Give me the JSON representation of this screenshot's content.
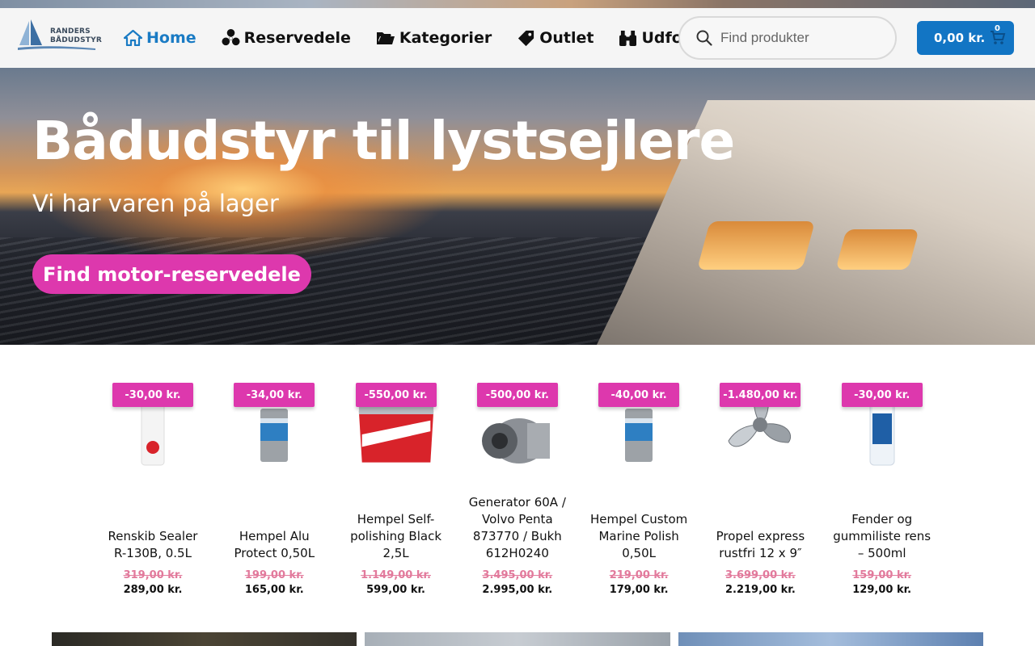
{
  "header": {
    "logo_line1": "RANDERS",
    "logo_line2": "BÅDUDSTYR",
    "nav": [
      {
        "label": "Home",
        "icon": "home-icon",
        "active": true
      },
      {
        "label": "Reservedele",
        "icon": "fan-icon"
      },
      {
        "label": "Kategorier",
        "icon": "folder-icon"
      },
      {
        "label": "Outlet",
        "icon": "tag-icon"
      },
      {
        "label": "Udforsk",
        "icon": "binoculars-icon"
      }
    ],
    "search_placeholder": "Find produkter",
    "cart_total": "0,00 kr.",
    "cart_count": "0"
  },
  "hero": {
    "title": "Bådudstyr til lystsejlere",
    "subtitle": "Vi har varen på lager",
    "button_label": "Find motor-reservedele"
  },
  "products": [
    {
      "badge": "-30,00 kr.",
      "name": "Renskib Sealer R-130B, 0.5L",
      "old_price": "319,00 kr.",
      "price": "289,00 kr."
    },
    {
      "badge": "-34,00 kr.",
      "name": "Hempel Alu Protect 0,50L",
      "old_price": "199,00 kr.",
      "price": "165,00 kr."
    },
    {
      "badge": "-550,00 kr.",
      "name": "Hempel Self-polishing Black 2,5L",
      "old_price": "1.149,00 kr.",
      "price": "599,00 kr."
    },
    {
      "badge": "-500,00 kr.",
      "name": "Generator 60A / Volvo Penta 873770 / Bukh 612H0240",
      "old_price": "3.495,00 kr.",
      "price": "2.995,00 kr."
    },
    {
      "badge": "-40,00 kr.",
      "name": "Hempel Custom Marine Polish 0,50L",
      "old_price": "219,00 kr.",
      "price": "179,00 kr."
    },
    {
      "badge": "-1.480,00 kr.",
      "name": "Propel express rustfri 12 x 9″",
      "old_price": "3.699,00 kr.",
      "price": "2.219,00 kr."
    },
    {
      "badge": "-30,00 kr.",
      "name": "Fender og gummiliste rens – 500ml",
      "old_price": "159,00 kr.",
      "price": "129,00 kr."
    }
  ],
  "colors": {
    "accent_blue": "#1275c4",
    "accent_pink": "#dd38ad",
    "nav_active": "#1a7bc4"
  }
}
